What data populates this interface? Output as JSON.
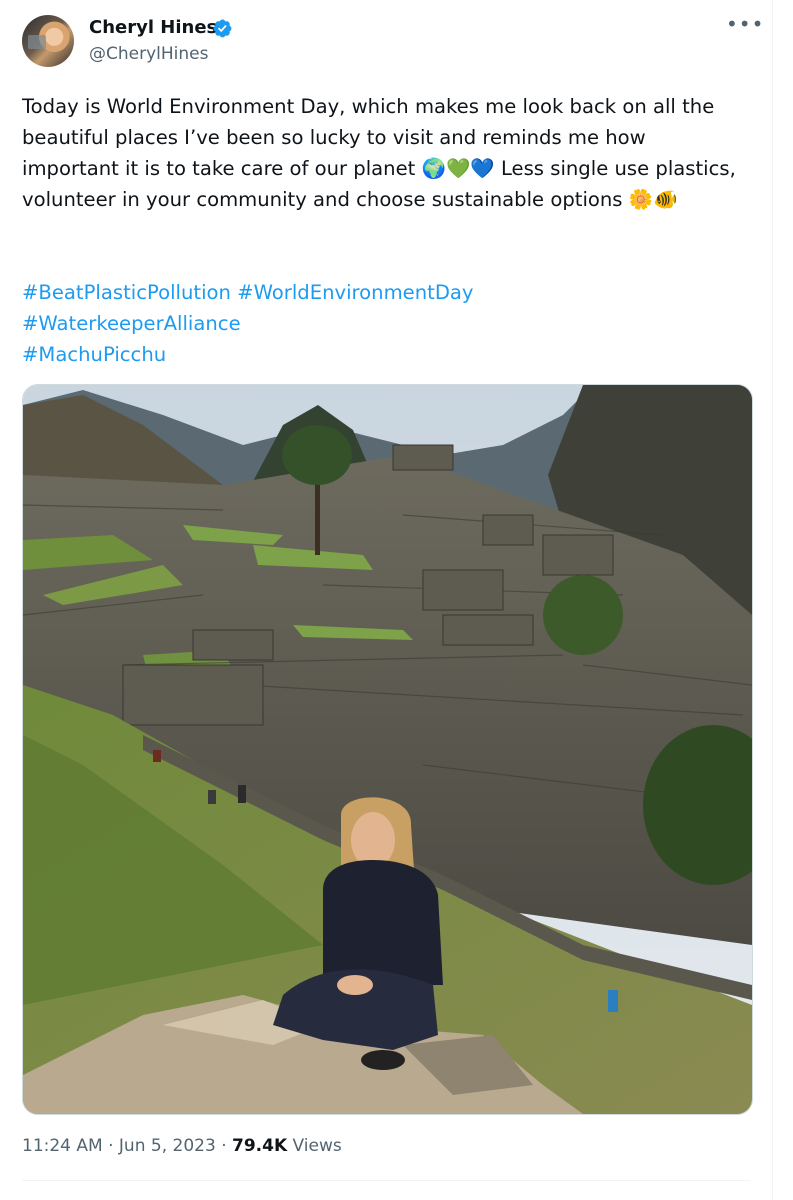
{
  "author": {
    "name": "Cheryl Hines",
    "handle": "@CherylHines",
    "verified": true,
    "avatar_icon": "profile-photo"
  },
  "menu": {
    "more_label": "•••"
  },
  "tweet": {
    "text": "Today is World Environment Day, which makes me look back on all the beautiful places I’ve been so lucky to visit and reminds me how important it is to take care of our planet 🌍💚💙 Less single use plastics, volunteer in your community and choose sustainable options 🌼🐠",
    "hashtags": [
      "#BeatPlasticPollution",
      "#WorldEnvironmentDay",
      "#WaterkeeperAlliance",
      "#MachuPicchu"
    ],
    "hashtag_color": "#1d9bf0"
  },
  "media": {
    "description_icon": "photo-machu-picchu-woman-sitting"
  },
  "meta": {
    "time": "11:24 AM",
    "separator": "·",
    "date": "Jun 5, 2023",
    "views_count": "79.4K",
    "views_label": "Views"
  },
  "colors": {
    "text": "#0f1419",
    "secondary": "#536471",
    "verified_badge": "#1d9bf0",
    "border": "#cfd9de"
  }
}
